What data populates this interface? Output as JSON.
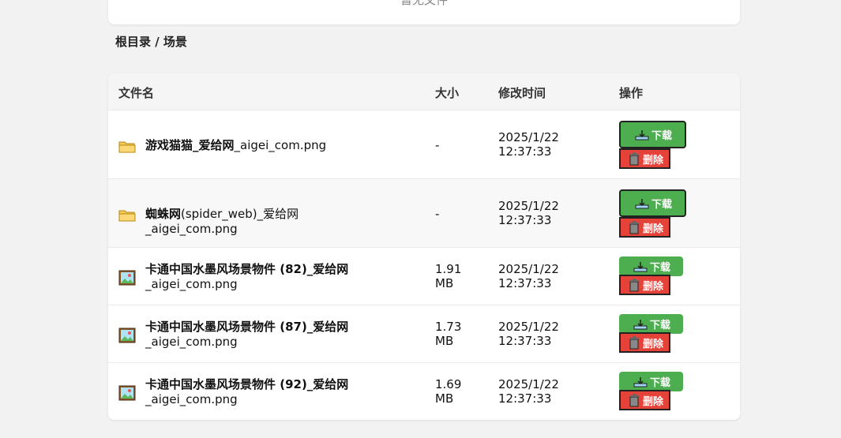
{
  "top_card": {
    "text": "暂无文件"
  },
  "breadcrumb": "根目录 / 场景",
  "table": {
    "headers": {
      "name": "文件名",
      "size": "大小",
      "time": "修改时间",
      "action": "操作"
    },
    "download_label": "下载",
    "delete_label": "删除",
    "rows": [
      {
        "type": "folder",
        "name_bold": "游戏猫猫_爱给网",
        "name_rest": "_aigei_com.png",
        "name_line2": "",
        "size_1": "-",
        "size_2": "",
        "time_1": "2025/1/22",
        "time_2": "12:37:33",
        "icon": "folder-icon"
      },
      {
        "type": "folder",
        "name_bold": "蜘蛛网",
        "name_rest": "(spider_web)_爱给网_aigei_com.png",
        "name_line2": "",
        "size_1": "-",
        "size_2": "",
        "time_1": "2025/1/22",
        "time_2": "12:37:33",
        "icon": "folder-icon"
      },
      {
        "type": "file",
        "name_bold": "卡通中国水墨风场景物件 (82)_爱给网",
        "name_rest": "",
        "name_line2": "_aigei_com.png",
        "size_1": "1.91",
        "size_2": "MB",
        "time_1": "2025/1/22",
        "time_2": "12:37:33",
        "icon": "image-icon"
      },
      {
        "type": "file",
        "name_bold": "卡通中国水墨风场景物件 (87)_爱给网",
        "name_rest": "",
        "name_line2": "_aigei_com.png",
        "size_1": "1.73",
        "size_2": "MB",
        "time_1": "2025/1/22",
        "time_2": "12:37:33",
        "icon": "image-icon"
      },
      {
        "type": "file",
        "name_bold": "卡通中国水墨风场景物件 (92)_爱给网",
        "name_rest": "",
        "name_line2": "_aigei_com.png",
        "size_1": "1.69",
        "size_2": "MB",
        "time_1": "2025/1/22",
        "time_2": "12:37:33",
        "icon": "image-icon"
      }
    ]
  },
  "colors": {
    "download": "#4cae4f",
    "delete": "#e5423a",
    "background": "#f2f2f2"
  }
}
